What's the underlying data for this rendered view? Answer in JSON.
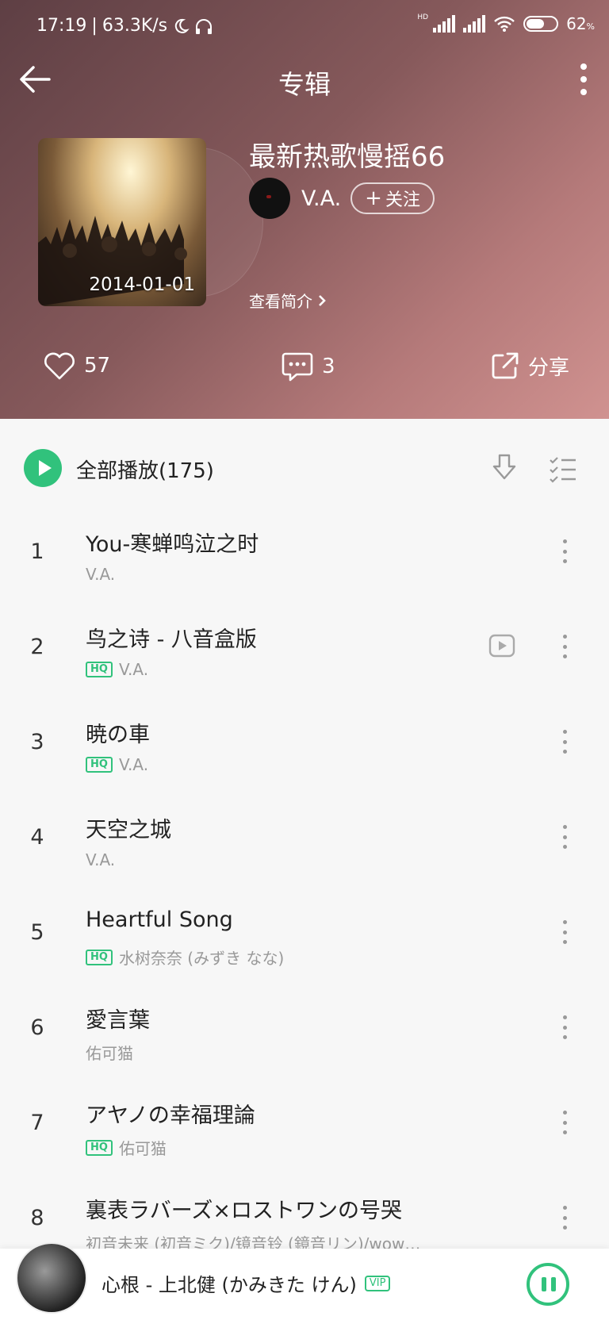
{
  "status": {
    "time": "17:19",
    "speed": "63.3K/s",
    "battery": "62",
    "battery_unit": "%",
    "battery_level": 0.62,
    "hd": "HD"
  },
  "nav": {
    "title": "专辑"
  },
  "album": {
    "name": "最新热歌慢摇66",
    "date": "2014-01-01",
    "artist": "V.A.",
    "follow_label": "关注",
    "intro_label": "查看简介"
  },
  "actions": {
    "likes": "57",
    "comments": "3",
    "share_label": "分享"
  },
  "playall": {
    "label": "全部播放(175)"
  },
  "songs": [
    {
      "num": "1",
      "title": "You-寒蝉鸣泣之时",
      "artist": "V.A.",
      "hq": false,
      "mv": false
    },
    {
      "num": "2",
      "title": "鸟之诗 - 八音盒版",
      "artist": "V.A.",
      "hq": true,
      "mv": true
    },
    {
      "num": "3",
      "title": "暁の車",
      "artist": "V.A.",
      "hq": true,
      "mv": false
    },
    {
      "num": "4",
      "title": "天空之城",
      "artist": "V.A.",
      "hq": false,
      "mv": false
    },
    {
      "num": "5",
      "title": "Heartful Song",
      "artist": "水树奈奈 (みずき なな)",
      "hq": true,
      "mv": false
    },
    {
      "num": "6",
      "title": "愛言葉",
      "artist": "佑可猫",
      "hq": false,
      "mv": false
    },
    {
      "num": "7",
      "title": "アヤノの幸福理論",
      "artist": "佑可猫",
      "hq": true,
      "mv": false
    },
    {
      "num": "8",
      "title": "裏表ラバーズ×ロストワンの号哭",
      "artist": "初音未来 (初音ミク)/镜音铃 (鏡音リン)/wow…",
      "hq": false,
      "mv": false
    }
  ],
  "hq_label": "HQ",
  "player": {
    "now_playing": "心根 - 上北健 (かみきた けん)",
    "vip_label": "VIP"
  },
  "colors": {
    "accent": "#31c27c",
    "header_start": "#5e3f44",
    "header_end": "#d09290"
  }
}
